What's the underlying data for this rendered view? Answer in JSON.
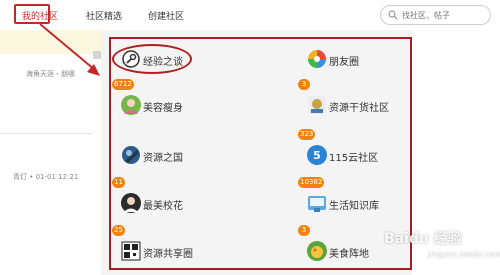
{
  "tabs": [
    {
      "label": "我的社区",
      "active": true
    },
    {
      "label": "社区精选",
      "active": false
    },
    {
      "label": "创建社区",
      "active": false
    }
  ],
  "search": {
    "placeholder": "找社区、帖子"
  },
  "feed": [
    {
      "meta": "海角天涯・朋哪"
    },
    {
      "meta": "青灯 • 01-01 12:21"
    }
  ],
  "communities": [
    {
      "name": "经验之谈",
      "icon": "key-icon",
      "badge": ""
    },
    {
      "name": "朋友圈",
      "icon": "pinwheel-icon",
      "badge": ""
    },
    {
      "name": "美容瘦身",
      "icon": "beauty-avatar-icon",
      "badge": "6712"
    },
    {
      "name": "资源干货社区",
      "icon": "resource-dry-goods-icon",
      "badge": "3"
    },
    {
      "name": "资源之国",
      "icon": "cartoon-character-icon",
      "badge": ""
    },
    {
      "name": "115云社区",
      "icon": "cloud-115-icon",
      "badge": "323"
    },
    {
      "name": "最美校花",
      "icon": "portrait-avatar-icon",
      "badge": "11"
    },
    {
      "name": "生活知识库",
      "icon": "life-knowledge-icon",
      "badge": "10382"
    },
    {
      "name": "资源共享圈",
      "icon": "share-circle-icon",
      "badge": "25"
    },
    {
      "name": "美食阵地",
      "icon": "food-icon",
      "badge": "3"
    }
  ],
  "watermark": {
    "main": "Baidu 经验",
    "sub": "jingyan.baidu.com"
  },
  "colors": {
    "annotation_red": "#c62828",
    "badge_orange": "#f3820d",
    "band_yellow": "#fcf8e0"
  }
}
